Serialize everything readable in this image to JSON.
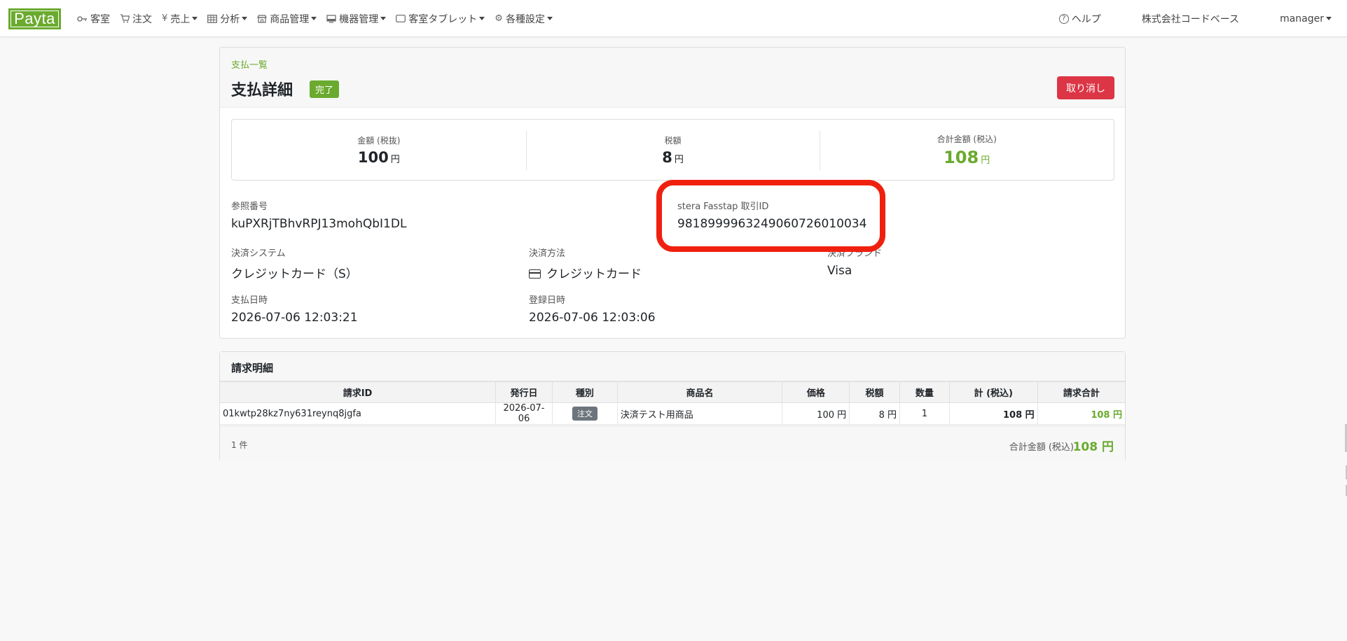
{
  "brand": {
    "logo_text": "Payta",
    "accent_color": "#6aaa2e"
  },
  "nav": {
    "items": [
      {
        "icon": "key-icon",
        "label": "客室",
        "dropdown": false
      },
      {
        "icon": "cart-icon",
        "label": "注文",
        "dropdown": false
      },
      {
        "icon": "yen-icon",
        "label": "売上",
        "dropdown": true
      },
      {
        "icon": "table-icon",
        "label": "分析",
        "dropdown": true
      },
      {
        "icon": "store-icon",
        "label": "商品管理",
        "dropdown": true
      },
      {
        "icon": "device-icon",
        "label": "機器管理",
        "dropdown": true
      },
      {
        "icon": "tablet-icon",
        "label": "客室タブレット",
        "dropdown": true
      },
      {
        "icon": "gear-icon",
        "label": "各種設定",
        "dropdown": true
      }
    ],
    "help_label": "ヘルプ",
    "company_label": "株式会社コードベース",
    "user_label": "manager"
  },
  "payment": {
    "breadcrumb": "支払一覧",
    "title": "支払詳細",
    "status": "完了",
    "cancel_label": "取り消し",
    "amounts": {
      "subtotal_label": "金額 (税抜)",
      "subtotal_value": "100",
      "subtotal_unit": "円",
      "tax_label": "税額",
      "tax_value": "8",
      "tax_unit": "円",
      "total_label": "合計金額 (税込)",
      "total_value": "108",
      "total_unit": "円"
    },
    "fields": {
      "reference_label": "参照番号",
      "reference_value": "kuPXRjTBhvRPJ13mohQbI1DL",
      "fasstap_label": "stera Fasstap 取引ID",
      "fasstap_value": "9818999963249060726010034",
      "system_label": "決済システム",
      "system_value": "クレジットカード（S）",
      "method_label": "決済方法",
      "method_value": "クレジットカード",
      "brand_label": "決済ブランド",
      "brand_value": "Visa",
      "paid_at_label": "支払日時",
      "paid_at_value": "2026-07-06 12:03:21",
      "registered_at_label": "登録日時",
      "registered_at_value": "2026-07-06 12:03:06"
    }
  },
  "invoice": {
    "title": "請求明細",
    "columns": [
      "請求ID",
      "発行日",
      "種別",
      "商品名",
      "価格",
      "税額",
      "数量",
      "計 (税込)",
      "請求合計"
    ],
    "rows": [
      {
        "id": "01kwtp28kz7ny631reynq8jgfa",
        "date": "2026-07-06",
        "type": "注文",
        "product": "決済テスト用商品",
        "price": "100 円",
        "tax": "8 円",
        "qty": "1",
        "subtotal": "108 円",
        "total": "108 円"
      }
    ],
    "count": "1 件",
    "total_label": "合計金額 (税込)",
    "total_value": "108 円"
  }
}
